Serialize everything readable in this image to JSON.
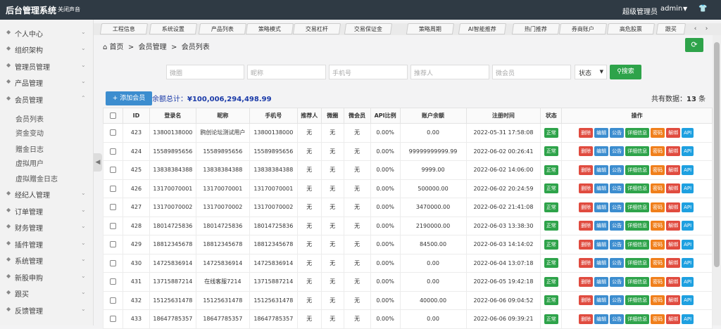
{
  "topbar": {
    "brand": "后台管理系统",
    "mute": "关闭声音",
    "role": "超级管理员",
    "user": "admin"
  },
  "sidebar": {
    "items": [
      {
        "label": "个人中心",
        "icon": "user-icon"
      },
      {
        "label": "组织架构",
        "icon": "org-icon"
      },
      {
        "label": "管理员管理",
        "icon": "admin-icon"
      },
      {
        "label": "产品管理",
        "icon": "product-icon"
      },
      {
        "label": "会员管理",
        "icon": "member-icon"
      },
      {
        "label": "经纪人管理",
        "icon": "broker-icon"
      },
      {
        "label": "订单管理",
        "icon": "order-icon"
      },
      {
        "label": "财务管理",
        "icon": "finance-icon"
      },
      {
        "label": "插件管理",
        "icon": "plugin-icon"
      },
      {
        "label": "系统管理",
        "icon": "system-icon"
      },
      {
        "label": "新股申购",
        "icon": "ipo-icon"
      },
      {
        "label": "跟买",
        "icon": "follow-icon"
      },
      {
        "label": "反馈管理",
        "icon": "feedback-icon"
      }
    ],
    "sub": [
      "会员列表",
      "资金变动",
      "赠金日志",
      "虚拟用户",
      "虚拟赠金日志"
    ]
  },
  "tabs": [
    "工程信息",
    "系统设置",
    "产品列表",
    "策略模式",
    "交易杠杆",
    "交易保证金",
    "策略周期",
    "AI智能推荐",
    "热门推荐",
    "券商账户",
    "高危股票",
    "跟买"
  ],
  "breadcrumb": {
    "home": "首页",
    "sep": ">",
    "level1": "会员管理",
    "level2": "会员列表"
  },
  "filters": {
    "p1": "微圈",
    "p2": "昵称",
    "p3": "手机号",
    "p4": "推荐人",
    "p5": "微会员",
    "status": "状态",
    "search": "搜索"
  },
  "add_label": "添加会员",
  "total": {
    "label": "余额总计：",
    "value": "¥100,006,294,498.99"
  },
  "count": {
    "prefix": "共有数据：",
    "num": "13",
    "suffix": "条"
  },
  "table": {
    "headers": [
      "",
      "ID",
      "登录名",
      "昵称",
      "手机号",
      "推荐人",
      "微圈",
      "微会员",
      "API比例",
      "账户余额",
      "注册时间",
      "状态",
      "操作"
    ],
    "actions": [
      "删除",
      "编辑",
      "公告",
      "详细信息",
      "密码",
      "解绑",
      "API"
    ],
    "rows": [
      {
        "id": "423",
        "login": "13800138000",
        "nick": "鸥创论坛测试用户",
        "phone": "13800138000",
        "ref": "无",
        "circle": "无",
        "vip": "无",
        "api": "0.00%",
        "bal": "0.00",
        "time": "2022-05-31 17:58:08",
        "status": "正常"
      },
      {
        "id": "424",
        "login": "15589895656",
        "nick": "15589895656",
        "phone": "15589895656",
        "ref": "无",
        "circle": "无",
        "vip": "无",
        "api": "0.00%",
        "bal": "99999999999.99",
        "time": "2022-06-02 00:26:41",
        "status": "正常"
      },
      {
        "id": "425",
        "login": "13838384388",
        "nick": "13838384388",
        "phone": "13838384388",
        "ref": "无",
        "circle": "无",
        "vip": "无",
        "api": "0.00%",
        "bal": "9999.00",
        "time": "2022-06-02 14:06:00",
        "status": "正常"
      },
      {
        "id": "426",
        "login": "13170070001",
        "nick": "13170070001",
        "phone": "13170070001",
        "ref": "无",
        "circle": "无",
        "vip": "无",
        "api": "0.00%",
        "bal": "500000.00",
        "time": "2022-06-02 20:24:59",
        "status": "正常"
      },
      {
        "id": "427",
        "login": "13170070002",
        "nick": "13170070002",
        "phone": "13170070002",
        "ref": "无",
        "circle": "无",
        "vip": "无",
        "api": "0.00%",
        "bal": "3470000.00",
        "time": "2022-06-02 21:41:08",
        "status": "正常"
      },
      {
        "id": "428",
        "login": "18014725836",
        "nick": "18014725836",
        "phone": "18014725836",
        "ref": "无",
        "circle": "无",
        "vip": "无",
        "api": "0.00%",
        "bal": "2190000.00",
        "time": "2022-06-03 13:38:30",
        "status": "正常"
      },
      {
        "id": "429",
        "login": "18812345678",
        "nick": "18812345678",
        "phone": "18812345678",
        "ref": "无",
        "circle": "无",
        "vip": "无",
        "api": "0.00%",
        "bal": "84500.00",
        "time": "2022-06-03 14:14:02",
        "status": "正常"
      },
      {
        "id": "430",
        "login": "14725836914",
        "nick": "14725836914",
        "phone": "14725836914",
        "ref": "无",
        "circle": "无",
        "vip": "无",
        "api": "0.00%",
        "bal": "0.00",
        "time": "2022-06-04 13:07:18",
        "status": "正常"
      },
      {
        "id": "431",
        "login": "13715887214",
        "nick": "在线客服7214",
        "phone": "13715887214",
        "ref": "无",
        "circle": "无",
        "vip": "无",
        "api": "0.00%",
        "bal": "0.00",
        "time": "2022-06-05 19:42:18",
        "status": "正常"
      },
      {
        "id": "432",
        "login": "15125631478",
        "nick": "15125631478",
        "phone": "15125631478",
        "ref": "无",
        "circle": "无",
        "vip": "无",
        "api": "0.00%",
        "bal": "40000.00",
        "time": "2022-06-06 09:04:52",
        "status": "正常"
      },
      {
        "id": "433",
        "login": "18647785357",
        "nick": "18647785357",
        "phone": "18647785357",
        "ref": "无",
        "circle": "无",
        "vip": "无",
        "api": "0.00%",
        "bal": "0.00",
        "time": "2022-06-06 09:39:21",
        "status": "正常"
      }
    ]
  }
}
